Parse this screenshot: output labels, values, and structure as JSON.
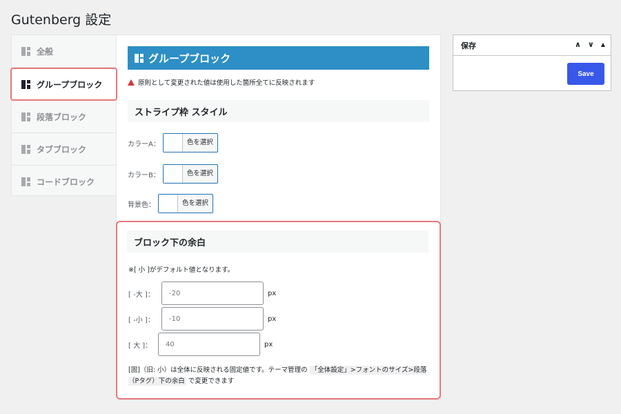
{
  "page": {
    "title": "Gutenberg 設定"
  },
  "tabs": [
    {
      "label": "全般"
    },
    {
      "label": "グループブロック"
    },
    {
      "label": "段落ブロック"
    },
    {
      "label": "タブブロック"
    },
    {
      "label": "コードブロック"
    }
  ],
  "main": {
    "header": "グループブロック",
    "notice": "原則として変更された値は使用した箇所全てに反映されます",
    "stripe_section": "ストライプ枠 スタイル",
    "color_a_label": "カラーA：",
    "color_b_label": "カラーB：",
    "bg_label": "背景色：",
    "color_button": "色を選択",
    "margin_section": "ブロック下の余白",
    "default_note": "※[ 小 ]がデフォルト値となります。",
    "fields": [
      {
        "label": "[ -大 ]：",
        "placeholder": "-20",
        "unit": "px"
      },
      {
        "label": "[ -小 ]：",
        "placeholder": "-10",
        "unit": "px"
      },
      {
        "label": "[ 大 ]：",
        "placeholder": "40",
        "unit": "px"
      }
    ],
    "foot_note_1": "[固]（旧: 小）は全体に反映される固定値です。テーマ管理の",
    "foot_note_code_1": "「全体設定」>フォントのサイズ>段落（Pタグ）下の余白",
    "foot_note_2": "で変更できます"
  },
  "save_box": {
    "title": "保存",
    "up": "∧",
    "down": "∨",
    "toggle": "▲",
    "save_label": "Save"
  },
  "colors": {
    "accent": "#2d8fc5",
    "highlight": "#e9777a",
    "button": "#3858e9",
    "warning": "#d63638"
  }
}
